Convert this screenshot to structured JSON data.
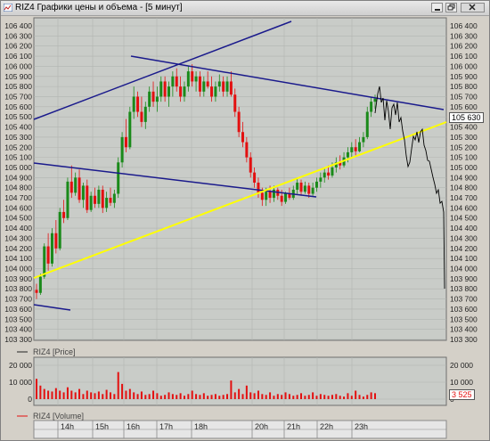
{
  "window": {
    "title": "RIZ4 Графики цены и объема - [5 минут]"
  },
  "colors": {
    "panel_bg": "#c9ccc8",
    "bull": "#1a8a1a",
    "bear": "#e31010",
    "channel": "#1a1a8c",
    "trend": "#ffff00",
    "forecast": "#000000",
    "volume": "#e31010"
  },
  "price_panel": {
    "legend_label": "RIZ4 [Price]",
    "last_value_label": "105 630",
    "tick_labels": [
      "106 400",
      "106 300",
      "106 200",
      "106 100",
      "106 000",
      "105 900",
      "105 800",
      "105 700",
      "105 600",
      "105 500",
      "105 400",
      "105 300",
      "105 200",
      "105 100",
      "105 000",
      "104 900",
      "104 800",
      "104 700",
      "104 600",
      "104 500",
      "104 400",
      "104 300",
      "104 200",
      "104 100",
      "104 000",
      "103 900",
      "103 800",
      "103 700",
      "103 600",
      "103 500",
      "103 400",
      "103 300"
    ]
  },
  "volume_panel": {
    "legend_label": "RIZ4 [Volume]",
    "last_value_label": "3 525",
    "tick_labels": [
      "20 000",
      "10 000",
      "0"
    ]
  },
  "time_axis": {
    "labels": [
      "14h",
      "15h",
      "16h",
      "17h",
      "18h",
      "20h",
      "21h",
      "22h",
      "23h"
    ]
  },
  "chart_data": {
    "type": "candlestick",
    "price_ylim": [
      103300,
      106450
    ],
    "volume_ylim": [
      0,
      23000
    ],
    "series": [
      {
        "name": "RIZ4 [Price]",
        "values": [
          [
            103790,
            103850,
            103700,
            103760
          ],
          [
            103760,
            103950,
            103740,
            103920
          ],
          [
            103920,
            104250,
            103900,
            104220
          ],
          [
            104220,
            104350,
            103980,
            104050
          ],
          [
            104050,
            104400,
            104020,
            104350
          ],
          [
            104350,
            104480,
            104150,
            104200
          ],
          [
            104200,
            104600,
            104180,
            104560
          ],
          [
            104560,
            104680,
            104450,
            104500
          ],
          [
            104500,
            104900,
            104480,
            104860
          ],
          [
            104860,
            105020,
            104700,
            104750
          ],
          [
            104750,
            104950,
            104720,
            104900
          ],
          [
            104900,
            104980,
            104650,
            104680
          ],
          [
            104680,
            104850,
            104600,
            104820
          ],
          [
            104820,
            104880,
            104550,
            104580
          ],
          [
            104580,
            104760,
            104560,
            104720
          ],
          [
            104720,
            104800,
            104600,
            104640
          ],
          [
            104640,
            104820,
            104600,
            104780
          ],
          [
            104780,
            104820,
            104550,
            104600
          ],
          [
            104600,
            104760,
            104560,
            104700
          ],
          [
            104700,
            104800,
            104620,
            104650
          ],
          [
            104650,
            104780,
            104600,
            104740
          ],
          [
            104740,
            105100,
            104700,
            105050
          ],
          [
            105050,
            105350,
            105000,
            105300
          ],
          [
            105300,
            105480,
            105150,
            105200
          ],
          [
            105200,
            105600,
            105180,
            105550
          ],
          [
            105550,
            105800,
            105480,
            105700
          ],
          [
            105700,
            105750,
            105500,
            105550
          ],
          [
            105550,
            105700,
            105400,
            105450
          ],
          [
            105450,
            105650,
            105380,
            105600
          ],
          [
            105600,
            105800,
            105550,
            105750
          ],
          [
            105750,
            105850,
            105600,
            105650
          ],
          [
            105650,
            105800,
            105550,
            105700
          ],
          [
            105700,
            105900,
            105650,
            105850
          ],
          [
            105850,
            105900,
            105650,
            105700
          ],
          [
            105700,
            105850,
            105600,
            105800
          ],
          [
            105800,
            105950,
            105700,
            105900
          ],
          [
            105900,
            105980,
            105750,
            105800
          ],
          [
            105800,
            105900,
            105650,
            105700
          ],
          [
            105700,
            105850,
            105650,
            105800
          ],
          [
            105800,
            106000,
            105750,
            105950
          ],
          [
            105950,
            106020,
            105800,
            105850
          ],
          [
            105850,
            105950,
            105750,
            105900
          ],
          [
            105900,
            105950,
            105700,
            105750
          ],
          [
            105750,
            105900,
            105700,
            105850
          ],
          [
            105850,
            105950,
            105780,
            105800
          ],
          [
            105800,
            105900,
            105650,
            105700
          ],
          [
            105700,
            105850,
            105650,
            105800
          ],
          [
            105800,
            105920,
            105750,
            105850
          ],
          [
            105850,
            105900,
            105700,
            105750
          ],
          [
            105750,
            105900,
            105700,
            105850
          ],
          [
            105850,
            105950,
            105700,
            105720
          ],
          [
            105720,
            105780,
            105500,
            105550
          ],
          [
            105550,
            105600,
            105300,
            105350
          ],
          [
            105350,
            105450,
            105200,
            105250
          ],
          [
            105250,
            105300,
            105050,
            105100
          ],
          [
            105100,
            105150,
            104900,
            104950
          ],
          [
            104950,
            105000,
            104800,
            104850
          ],
          [
            104850,
            104900,
            104700,
            104750
          ],
          [
            104750,
            104800,
            104620,
            104680
          ],
          [
            104680,
            104800,
            104620,
            104760
          ],
          [
            104760,
            104820,
            104650,
            104700
          ],
          [
            104700,
            104820,
            104660,
            104780
          ],
          [
            104780,
            104800,
            104680,
            104720
          ],
          [
            104720,
            104780,
            104620,
            104660
          ],
          [
            104660,
            104760,
            104640,
            104740
          ],
          [
            104740,
            104800,
            104680,
            104700
          ],
          [
            104700,
            104820,
            104680,
            104780
          ],
          [
            104780,
            104900,
            104740,
            104850
          ],
          [
            104850,
            104880,
            104720,
            104760
          ],
          [
            104760,
            104860,
            104740,
            104820
          ],
          [
            104820,
            104850,
            104700,
            104740
          ],
          [
            104740,
            104850,
            104720,
            104800
          ],
          [
            104800,
            104900,
            104760,
            104860
          ],
          [
            104860,
            104950,
            104800,
            104900
          ],
          [
            104900,
            105000,
            104850,
            104950
          ],
          [
            104950,
            105020,
            104880,
            104920
          ],
          [
            104920,
            105050,
            104900,
            105000
          ],
          [
            105000,
            105100,
            104950,
            105050
          ],
          [
            105050,
            105120,
            104980,
            105020
          ],
          [
            105020,
            105150,
            105000,
            105100
          ],
          [
            105100,
            105200,
            105050,
            105150
          ],
          [
            105150,
            105250,
            105100,
            105200
          ],
          [
            105200,
            105280,
            105120,
            105160
          ],
          [
            105160,
            105300,
            105150,
            105250
          ],
          [
            105250,
            105350,
            105200,
            105300
          ],
          [
            105300,
            105600,
            105280,
            105550
          ],
          [
            105550,
            105700,
            105500,
            105650
          ],
          [
            105650,
            105720,
            105580,
            105680
          ]
        ]
      },
      {
        "name": "Volume",
        "values": [
          12000,
          8000,
          6000,
          5000,
          4500,
          6500,
          5000,
          4000,
          7000,
          5000,
          4000,
          6000,
          3000,
          5000,
          4000,
          3500,
          4500,
          3000,
          5500,
          4000,
          3000,
          16000,
          9000,
          5000,
          6000,
          4000,
          3000,
          4500,
          2500,
          3000,
          5000,
          3500,
          2000,
          2500,
          4000,
          3000,
          2500,
          3500,
          2000,
          3000,
          5000,
          3000,
          2500,
          3500,
          2000,
          2500,
          3000,
          2000,
          2500,
          3000,
          11000,
          4000,
          6000,
          3000,
          8000,
          4000,
          3500,
          5000,
          3000,
          2500,
          4000,
          2000,
          3000,
          2500,
          4000,
          3000,
          2000,
          2500,
          3500,
          2000,
          2500,
          4000,
          2000,
          3000,
          2500,
          2000,
          2500,
          3000,
          2000,
          1500,
          3500,
          2000,
          5000,
          2500,
          1500,
          2500,
          4000,
          3500
        ]
      }
    ]
  }
}
